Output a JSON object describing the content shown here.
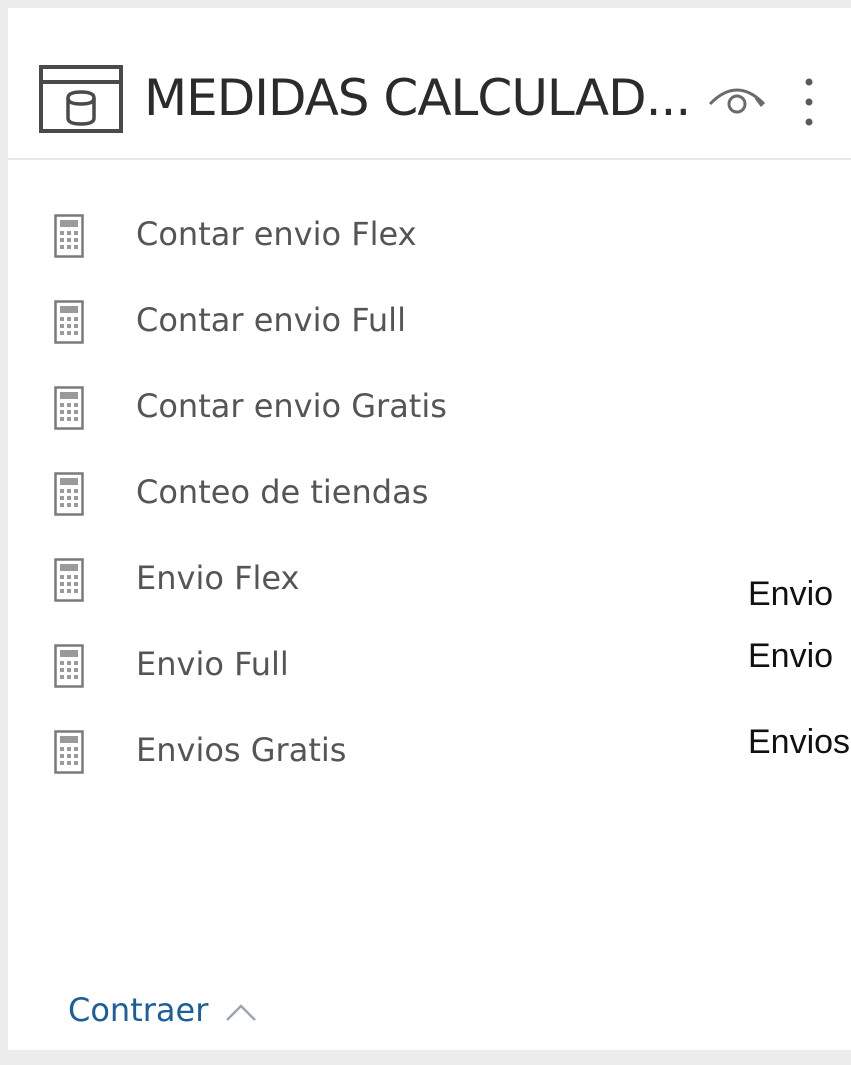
{
  "panel": {
    "title": "MEDIDAS CALCULAD...",
    "icons": {
      "table": "table-icon",
      "visibility": "eye-icon",
      "more": "more-options-icon",
      "measure": "calculator-icon",
      "collapse": "chevron-up-icon"
    },
    "measures": [
      {
        "label": "Contar envio Flex"
      },
      {
        "label": "Contar envio Full"
      },
      {
        "label": "Contar envio Gratis"
      },
      {
        "label": "Conteo de tiendas"
      },
      {
        "label": "Envio Flex"
      },
      {
        "label": "Envio Full"
      },
      {
        "label": "Envios Gratis"
      }
    ],
    "collapse_label": "Contraer"
  },
  "overflow_labels": [
    {
      "text": "Envio"
    },
    {
      "text": "Envio"
    },
    {
      "text": "Envios"
    }
  ],
  "colors": {
    "title": "#2b2b2b",
    "item_text": "#555555",
    "link": "#1a5e9c",
    "background": "#ececec",
    "card": "#ffffff"
  }
}
